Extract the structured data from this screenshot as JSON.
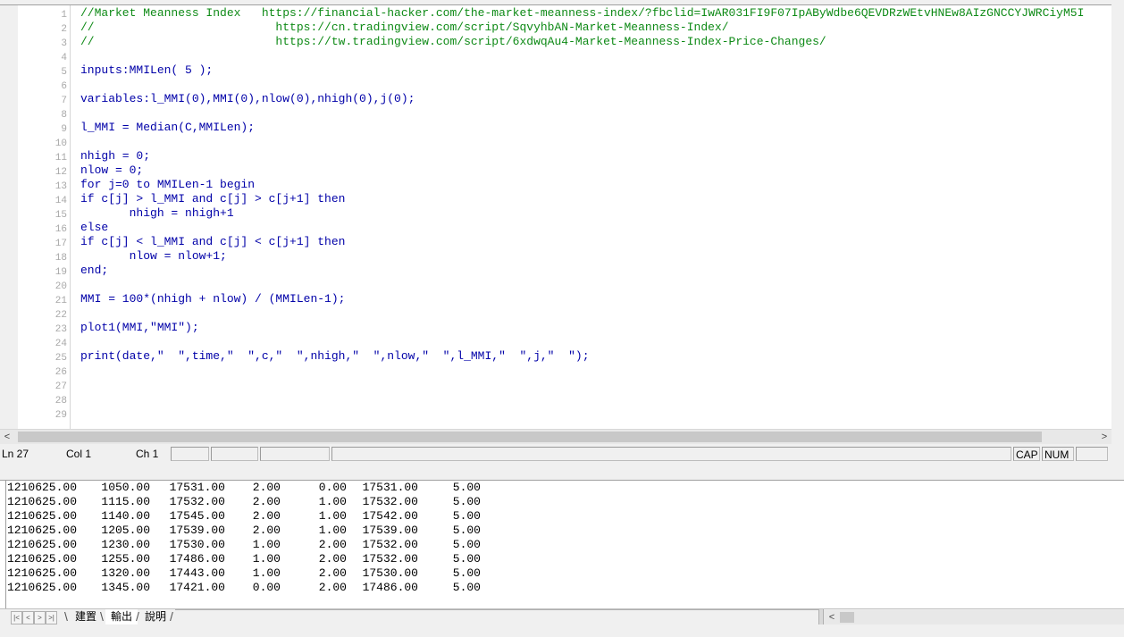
{
  "editor": {
    "line_numbers": [
      "1",
      "2",
      "3",
      "4",
      "5",
      "6",
      "7",
      "8",
      "9",
      "10",
      "11",
      "12",
      "13",
      "14",
      "15",
      "16",
      "17",
      "18",
      "19",
      "20",
      "21",
      "22",
      "23",
      "24",
      "25",
      "26",
      "27",
      "28",
      "29"
    ],
    "lines": [
      {
        "text": "//Market Meanness Index   https://financial-hacker.com/the-market-meanness-index/?fbclid=IwAR031FI9F07IpAByWdbe6QEVDRzWEtvHNEw8AIzGNCCYJWRCiyM5I",
        "type": "comment"
      },
      {
        "text": "//                          https://cn.tradingview.com/script/SqvyhbAN-Market-Meanness-Index/",
        "type": "comment"
      },
      {
        "text": "//                          https://tw.tradingview.com/script/6xdwqAu4-Market-Meanness-Index-Price-Changes/",
        "type": "comment"
      },
      {
        "text": "",
        "type": "code"
      },
      {
        "text": "inputs:MMILen( 5 );",
        "type": "code"
      },
      {
        "text": "",
        "type": "code"
      },
      {
        "text": "variables:l_MMI(0),MMI(0),nlow(0),nhigh(0),j(0);",
        "type": "code"
      },
      {
        "text": "",
        "type": "code"
      },
      {
        "text": "l_MMI = Median(C,MMILen);",
        "type": "code"
      },
      {
        "text": "",
        "type": "code"
      },
      {
        "text": "nhigh = 0;",
        "type": "code"
      },
      {
        "text": "nlow = 0;",
        "type": "code"
      },
      {
        "text": "for j=0 to MMILen-1 begin",
        "type": "code"
      },
      {
        "text": "if c[j] > l_MMI and c[j] > c[j+1] then",
        "type": "code"
      },
      {
        "text": "       nhigh = nhigh+1",
        "type": "code"
      },
      {
        "text": "else",
        "type": "code"
      },
      {
        "text": "if c[j] < l_MMI and c[j] < c[j+1] then",
        "type": "code"
      },
      {
        "text": "       nlow = nlow+1;",
        "type": "code"
      },
      {
        "text": "end;",
        "type": "code"
      },
      {
        "text": "",
        "type": "code"
      },
      {
        "text": "MMI = 100*(nhigh + nlow) / (MMILen-1);",
        "type": "code"
      },
      {
        "text": "",
        "type": "code"
      },
      {
        "text": "plot1(MMI,\"MMI\");",
        "type": "code"
      },
      {
        "text": "",
        "type": "code"
      },
      {
        "text": "print(date,\"  \",time,\"  \",c,\"  \",nhigh,\"  \",nlow,\"  \",l_MMI,\"  \",j,\"  \");",
        "type": "code"
      }
    ],
    "scroll_left_arrow": "<",
    "scroll_right_arrow": ">"
  },
  "statusbar": {
    "line": "Ln 27",
    "col": "Col 1",
    "ch": "Ch 1",
    "cap": "CAP",
    "num": "NUM"
  },
  "output": {
    "rows": [
      [
        "1210625.00",
        "1050.00",
        "17531.00",
        "2.00",
        "0.00",
        "17531.00",
        "5.00"
      ],
      [
        "1210625.00",
        "1115.00",
        "17532.00",
        "2.00",
        "1.00",
        "17532.00",
        "5.00"
      ],
      [
        "1210625.00",
        "1140.00",
        "17545.00",
        "2.00",
        "1.00",
        "17542.00",
        "5.00"
      ],
      [
        "1210625.00",
        "1205.00",
        "17539.00",
        "2.00",
        "1.00",
        "17539.00",
        "5.00"
      ],
      [
        "1210625.00",
        "1230.00",
        "17530.00",
        "1.00",
        "2.00",
        "17532.00",
        "5.00"
      ],
      [
        "1210625.00",
        "1255.00",
        "17486.00",
        "1.00",
        "2.00",
        "17532.00",
        "5.00"
      ],
      [
        "1210625.00",
        "1320.00",
        "17443.00",
        "1.00",
        "2.00",
        "17530.00",
        "5.00"
      ],
      [
        "1210625.00",
        "1345.00",
        "17421.00",
        "0.00",
        "2.00",
        "17486.00",
        "5.00"
      ]
    ]
  },
  "tabs": {
    "nav": [
      "|<",
      "<",
      ">",
      ">|"
    ],
    "items": [
      {
        "label": "建置",
        "active": false
      },
      {
        "label": "輸出",
        "active": true
      },
      {
        "label": "說明",
        "active": false
      }
    ],
    "scroll_left_arrow": "<"
  },
  "colors": {
    "code": "#0000a8",
    "comment": "#0e8a16",
    "line_number": "#a8a8a8"
  }
}
